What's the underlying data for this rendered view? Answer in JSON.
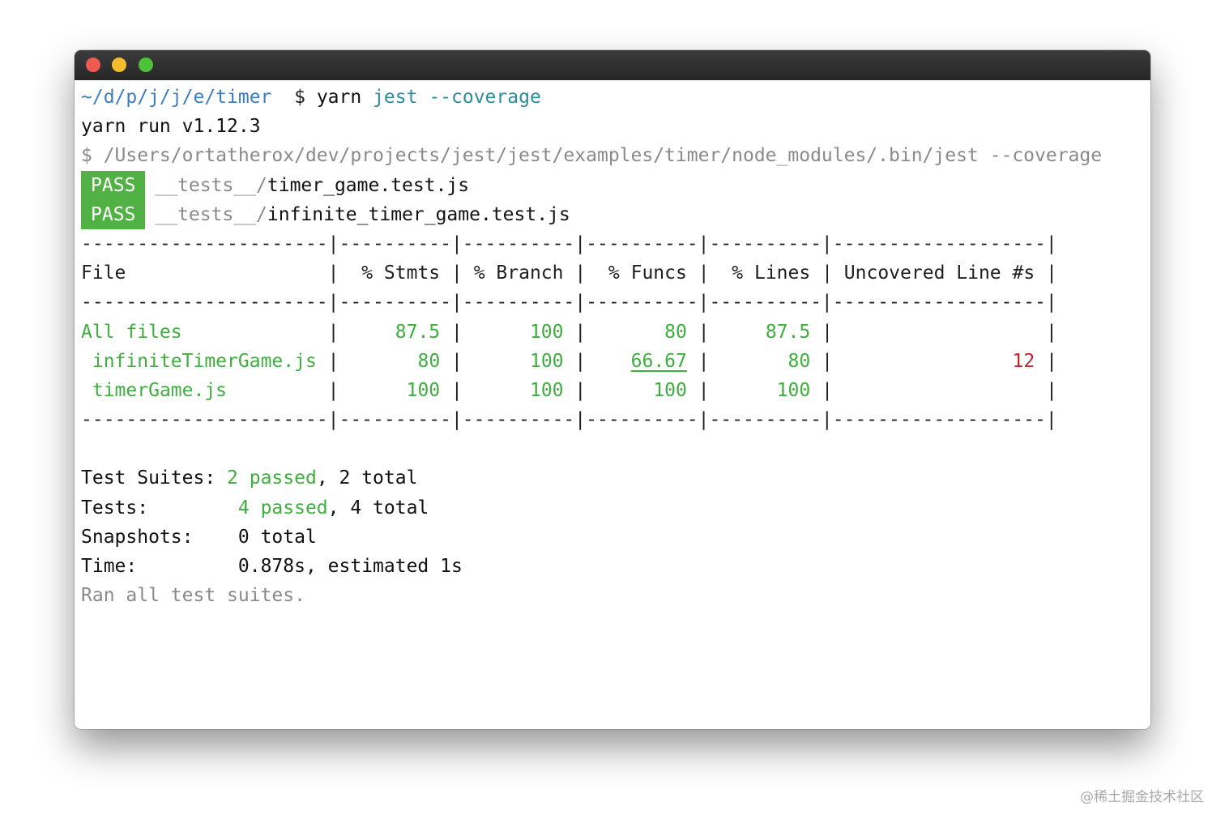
{
  "terminal": {
    "prompt": {
      "path": "~/d/p/j/j/e/timer",
      "symbol": "$",
      "command": "yarn",
      "args": "jest --coverage"
    },
    "yarn_version_line": "yarn run v1.12.3",
    "exec_line": "$ /Users/ortatherox/dev/projects/jest/jest/examples/timer/node_modules/.bin/jest --coverage",
    "results": [
      {
        "badge": "PASS",
        "dir": "__tests__/",
        "file": "timer_game.test.js"
      },
      {
        "badge": "PASS",
        "dir": "__tests__/",
        "file": "infinite_timer_game.test.js"
      }
    ],
    "coverage_table": {
      "separator": "----------------------|----------|----------|----------|----------|-------------------|",
      "headers": [
        "File",
        "% Stmts",
        "% Branch",
        "% Funcs",
        "% Lines",
        "Uncovered Line #s"
      ],
      "rows": [
        {
          "file": "All files",
          "stmts": "87.5",
          "branch": "100",
          "funcs": "80",
          "lines": "87.5",
          "uncovered": ""
        },
        {
          "file": "infiniteTimerGame.js",
          "stmts": "80",
          "branch": "100",
          "funcs": "66.67",
          "lines": "80",
          "uncovered": "12"
        },
        {
          "file": "timerGame.js",
          "stmts": "100",
          "branch": "100",
          "funcs": "100",
          "lines": "100",
          "uncovered": ""
        }
      ]
    },
    "summary": {
      "suites_label": "Test Suites:",
      "suites_passed": "2 passed",
      "suites_total": ", 2 total",
      "tests_label": "Tests:",
      "tests_passed": "4 passed",
      "tests_total": ", 4 total",
      "snapshots_label": "Snapshots:",
      "snapshots_value": "0 total",
      "time_label": "Time:",
      "time_value": "0.878s, estimated 1s",
      "footer": "Ran all test suites."
    }
  },
  "watermark": "@稀土掘金技术社区",
  "colors": {
    "pass_badge": "#51b145",
    "pass_text": "#3fae3f",
    "uncovered_text": "#c0262c",
    "prompt_path": "#3a7ec1",
    "titlebar": "#2f2f2f"
  }
}
